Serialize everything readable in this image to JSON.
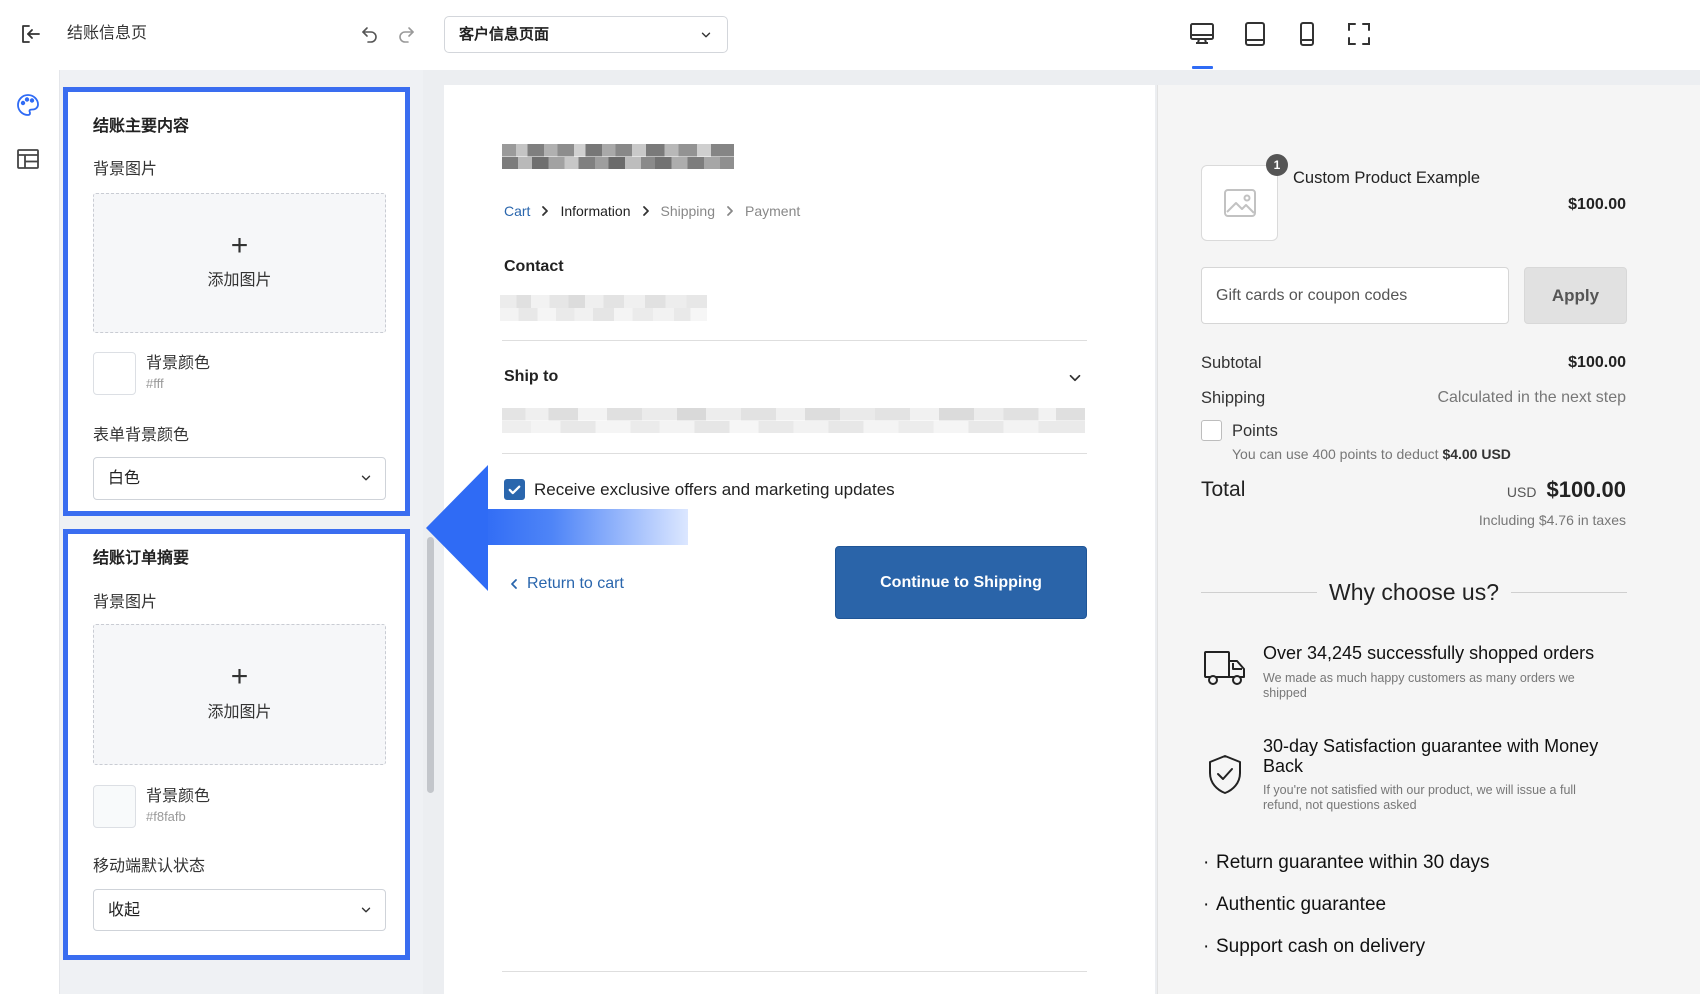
{
  "topbar": {
    "title": "结账信息页",
    "page_select": "客户信息页面",
    "devices": [
      "desktop",
      "tablet",
      "mobile",
      "fullscreen"
    ],
    "active_device": "desktop"
  },
  "panel": {
    "sections": [
      {
        "title": "结账主要内容",
        "bg_image_label": "背景图片",
        "upload_label": "添加图片",
        "bg_color_label": "背景颜色",
        "bg_color_value": "#fff",
        "field_label": "表单背景颜色",
        "field_value": "白色"
      },
      {
        "title": "结账订单摘要",
        "bg_image_label": "背景图片",
        "upload_label": "添加图片",
        "bg_color_label": "背景颜色",
        "bg_color_value": "#f8fafb",
        "field_label": "移动端默认状态",
        "field_value": "收起"
      }
    ]
  },
  "checkout": {
    "breadcrumb": [
      "Cart",
      "Information",
      "Shipping",
      "Payment"
    ],
    "contact_label": "Contact",
    "ship_to_label": "Ship to",
    "marketing_label": "Receive exclusive offers and marketing updates",
    "marketing_checked": true,
    "return_label": "Return to cart",
    "continue_label": "Continue to Shipping"
  },
  "summary": {
    "product": {
      "name": "Custom Product Example",
      "price": "$100.00",
      "quantity": "1"
    },
    "coupon_placeholder": "Gift cards or coupon codes",
    "apply_label": "Apply",
    "subtotal_label": "Subtotal",
    "subtotal_value": "$100.00",
    "shipping_label": "Shipping",
    "shipping_value": "Calculated in the next step",
    "points_label": "Points",
    "points_checked": false,
    "points_note_prefix": "You can use 400 points to deduct",
    "points_note_amount": "$4.00 USD",
    "total_label": "Total",
    "total_currency": "USD",
    "total_value": "$100.00",
    "tax_note": "Including $4.76 in taxes",
    "why_title": "Why choose us?",
    "features": [
      {
        "title": "Over 34,245 successfully shopped orders",
        "subtitle": "We made as much happy customers as many orders we shipped",
        "icon": "truck-icon"
      },
      {
        "title": "30-day Satisfaction guarantee with Money Back",
        "subtitle": "If you're not satisfied with our product, we will issue a full refund, not questions asked",
        "icon": "shield-check-icon"
      }
    ],
    "bullets": [
      "Return guarantee within 30 days",
      "Authentic guarantee",
      "Support cash on delivery"
    ]
  },
  "colors": {
    "highlight": "#3a6df0",
    "primary_button": "#2a64a9",
    "link": "#2a66ad",
    "active_tab": "#2f6bf5"
  },
  "icons": {
    "exit": "exit-icon",
    "undo": "undo-icon",
    "redo": "redo-icon",
    "theme": "palette-icon",
    "layout": "layout-icon",
    "product_placeholder": "image-placeholder-icon"
  }
}
